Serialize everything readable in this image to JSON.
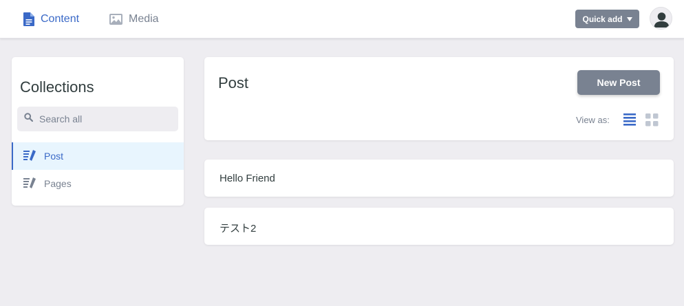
{
  "topbar": {
    "nav": [
      {
        "label": "Content",
        "icon": "document-icon",
        "active": true
      },
      {
        "label": "Media",
        "icon": "image-icon",
        "active": false
      }
    ],
    "quick_add_label": "Quick add",
    "avatar_icon": "user-icon"
  },
  "sidebar": {
    "title": "Collections",
    "search_placeholder": "Search all",
    "search_value": "",
    "items": [
      {
        "label": "Post",
        "icon": "collection-icon",
        "active": true
      },
      {
        "label": "Pages",
        "icon": "collection-icon",
        "active": false
      }
    ]
  },
  "main": {
    "title": "Post",
    "new_button_label": "New Post",
    "view_as_label": "View as:",
    "view_modes": [
      "list-view-icon",
      "grid-view-icon"
    ],
    "active_view": "list",
    "entries": [
      {
        "title": "Hello Friend"
      },
      {
        "title": "テスト2"
      }
    ]
  },
  "colors": {
    "accent": "#3a69c7",
    "button_gray": "#798291",
    "background": "#eeedf1",
    "active_row": "#e8f5fe",
    "inactive_icon": "#c0c7d2"
  }
}
